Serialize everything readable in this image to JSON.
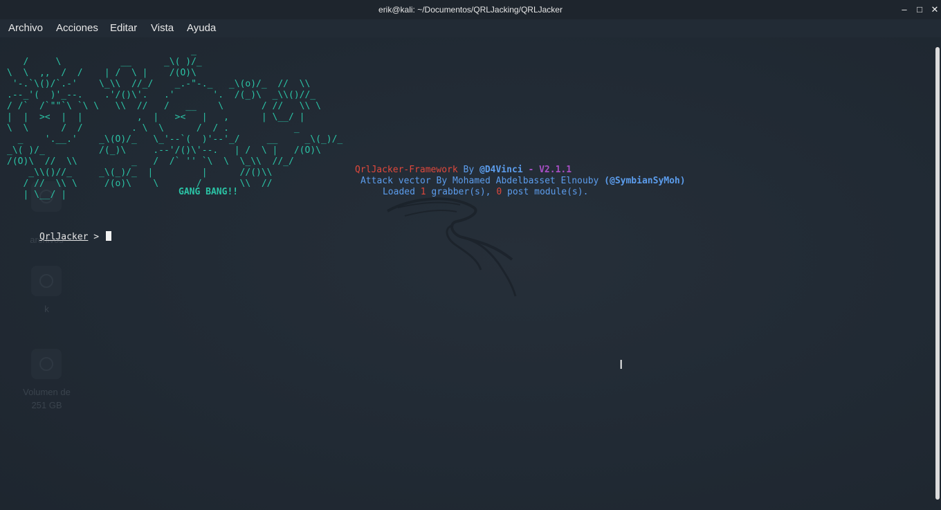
{
  "window": {
    "title": "erik@kali: ~/Documentos/QRLJacking/QRLJacker",
    "minimize_glyph": "–",
    "maximize_glyph": "□",
    "close_glyph": "✕"
  },
  "menu": {
    "items": [
      "Archivo",
      "Acciones",
      "Editar",
      "Vista",
      "Ayuda"
    ]
  },
  "desktop": {
    "icon_labels": [
      "archivos",
      "k",
      "Volumen de",
      "251 GB"
    ]
  },
  "terminal": {
    "ascii_art": "                                  _\n   /     \\           __      _\\( )/_\n\\  \\  ,,  /  /    | /  \\ |    /(O)\\\n '-.`\\()/`.-'    \\_\\\\  //_/    _.-\"-._   _\\(o)/_  //  \\\\\n.--_'(  )'_--.    .'/()\\'.   .'       '.  /(_)\\  _\\\\()//_\n/ /`  /`\"\"`\\ `\\ \\   \\\\  //   /   __    \\       / //   \\\\ \\\n|  |  ><  |  |          ,  |   ><   |   ,      | \\__/ |\n\\  \\      /  /         . \\  \\      /  / .            _\n  _    '.__.'    _\\(O)/_   \\_'--`(  )'--'_/     __     _\\(_)/_\n_\\( )/_          /(_)\\     .--'/()\\'--.   | /  \\ |   /(O)\\\n/(O)\\  //  \\\\          _   /  /` '' `\\  \\  \\_\\\\  //_/\n    _\\\\()//_     _\\(_)/_  |         |      //()\\\\\n   / //  \\\\ \\     /(o)\\    \\       /       \\\\  //\n   | \\__/ |",
    "gang_text": "GANG BANG!!",
    "framework_name": "QrlJacker-Framework",
    "by_word": " By ",
    "author": "@D4Vinci",
    "dash": " - ",
    "version": "V2.1.1",
    "attack_text": "Attack vector By Mohamed Abdelbasset Elnouby ",
    "attack_handle": "(@SymbianSyMoh)",
    "loaded_prefix": "Loaded ",
    "grabbers_count": "1",
    "grabbers_mid": " grabber(s), ",
    "post_count": "0",
    "post_suffix": " post module(s).",
    "prompt": "QrlJacker",
    "prompt_symbol": " > "
  },
  "colors": {
    "ascii": "#2bc4a6",
    "red": "#e0483c",
    "blue": "#5c9ded",
    "purple": "#a84fc5",
    "background": "#222b35"
  }
}
